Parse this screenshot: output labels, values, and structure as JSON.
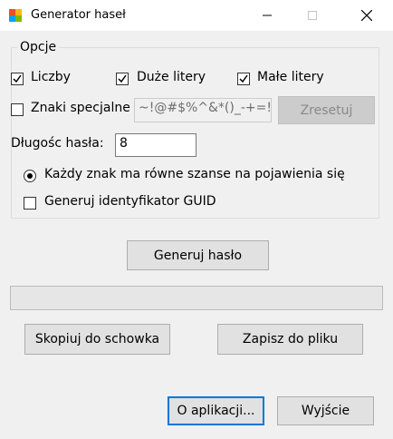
{
  "window": {
    "title": "Generator haseł"
  },
  "options": {
    "group_label": "Opcje",
    "digits_label": "Liczby",
    "digits_checked": true,
    "upper_label": "Duże litery",
    "upper_checked": true,
    "lower_label": "Małe litery",
    "lower_checked": true,
    "special_label": "Znaki specjalne",
    "special_checked": false,
    "special_value": "~!@#$%^&*()_-+=!",
    "reset_label": "Zresetuj",
    "length_label": "Długośc hasła:",
    "length_value": "8",
    "equal_chance_label": "Każdy znak ma równe szanse na pojawienia się",
    "equal_chance_selected": true,
    "guid_label": "Generuj identyfikator GUID",
    "guid_checked": false
  },
  "actions": {
    "generate_label": "Generuj hasło",
    "password_output": "",
    "copy_label": "Skopiuj do schowka",
    "save_label": "Zapisz do pliku",
    "about_label": "O aplikacji...",
    "exit_label": "Wyjście"
  }
}
